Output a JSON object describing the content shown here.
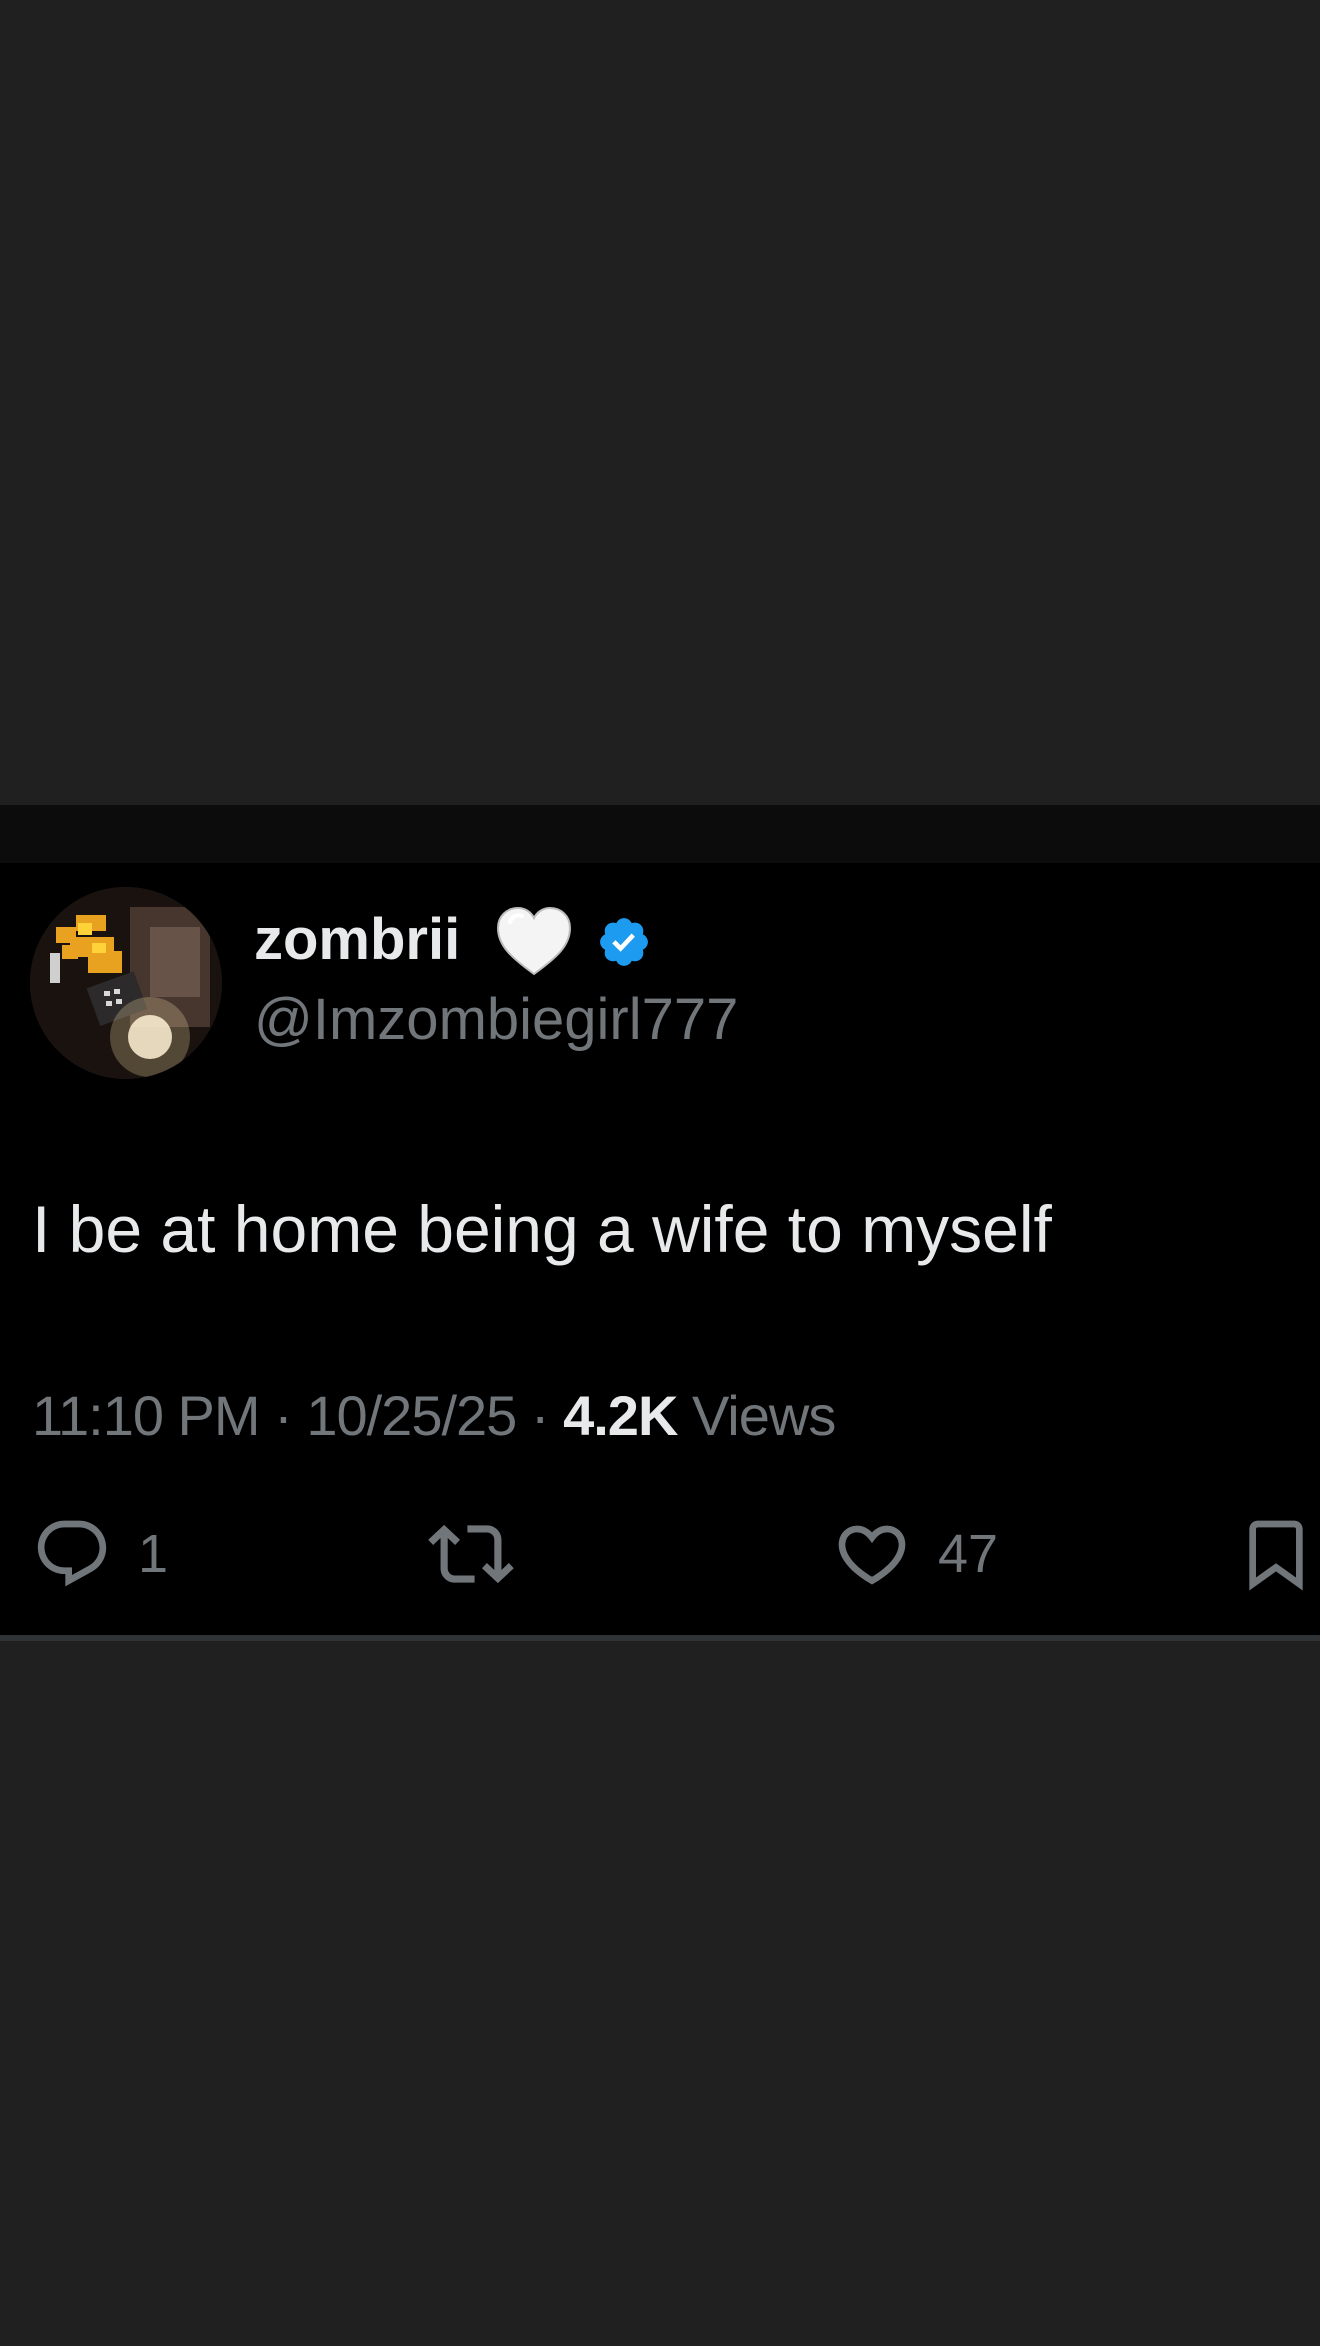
{
  "tweet": {
    "display_name": "zombrii",
    "name_emoji": "white-heart",
    "verified": true,
    "verified_color": "#1d9bf0",
    "handle": "@Imzombiegirl777",
    "text": "I be at home being a wife to myself",
    "time": "11:10 PM",
    "date": "10/25/25",
    "separator": "·",
    "views_count": "4.2K",
    "views_label": "Views"
  },
  "actions": {
    "reply": {
      "icon": "reply-icon",
      "count": "1"
    },
    "retweet": {
      "icon": "retweet-icon",
      "count": ""
    },
    "like": {
      "icon": "heart-icon",
      "count": "47"
    },
    "bookmark": {
      "icon": "bookmark-icon"
    }
  },
  "colors": {
    "page_background": "#202020",
    "tweet_background": "#000000",
    "primary_text": "#e7e9ea",
    "secondary_text": "#71767b"
  }
}
